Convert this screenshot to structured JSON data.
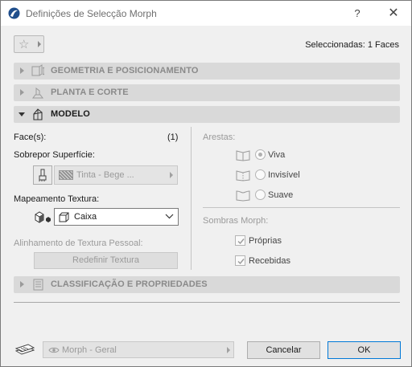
{
  "window": {
    "title": "Definições de Selecção Morph",
    "help_glyph": "?",
    "close_glyph": "✕"
  },
  "toolbar": {
    "favorites_icon": "star-icon",
    "selected_count": "Seleccionadas: 1 Faces"
  },
  "sections": {
    "geometry": {
      "label": "GEOMETRIA E POSICIONAMENTO",
      "expanded": false
    },
    "plan": {
      "label": "PLANTA E CORTE",
      "expanded": false
    },
    "model": {
      "label": "MODELO",
      "expanded": true
    },
    "classification": {
      "label": "CLASSIFICAÇÃO E PROPRIEDADES",
      "expanded": false
    }
  },
  "model": {
    "faces_label": "Face(s):",
    "faces_count": "(1)",
    "override_label": "Sobrepor Superfície:",
    "surface_value": "Tinta - Bege ...",
    "texture_mapping_label": "Mapeamento Textura:",
    "texture_mapping_value": "Caixa",
    "texture_align_label": "Alinhamento de Textura Pessoal:",
    "redefine_button": "Redefinir Textura",
    "edges_label": "Arestas:",
    "edges": [
      {
        "label": "Viva",
        "checked": true
      },
      {
        "label": "Invisível",
        "checked": false
      },
      {
        "label": "Suave",
        "checked": false
      }
    ],
    "shadows_label": "Sombras Morph:",
    "shadows": [
      {
        "label": "Próprias",
        "checked": true
      },
      {
        "label": "Recebidas",
        "checked": true
      }
    ]
  },
  "footer": {
    "layer_value": "Morph - Geral",
    "cancel_label": "Cancelar",
    "ok_label": "OK"
  },
  "colors": {
    "panel_bg": "#f0f0f0",
    "section_header_bg": "#d9d9d9",
    "ok_border": "#0078d7",
    "disabled_text": "#9a9a9a"
  }
}
